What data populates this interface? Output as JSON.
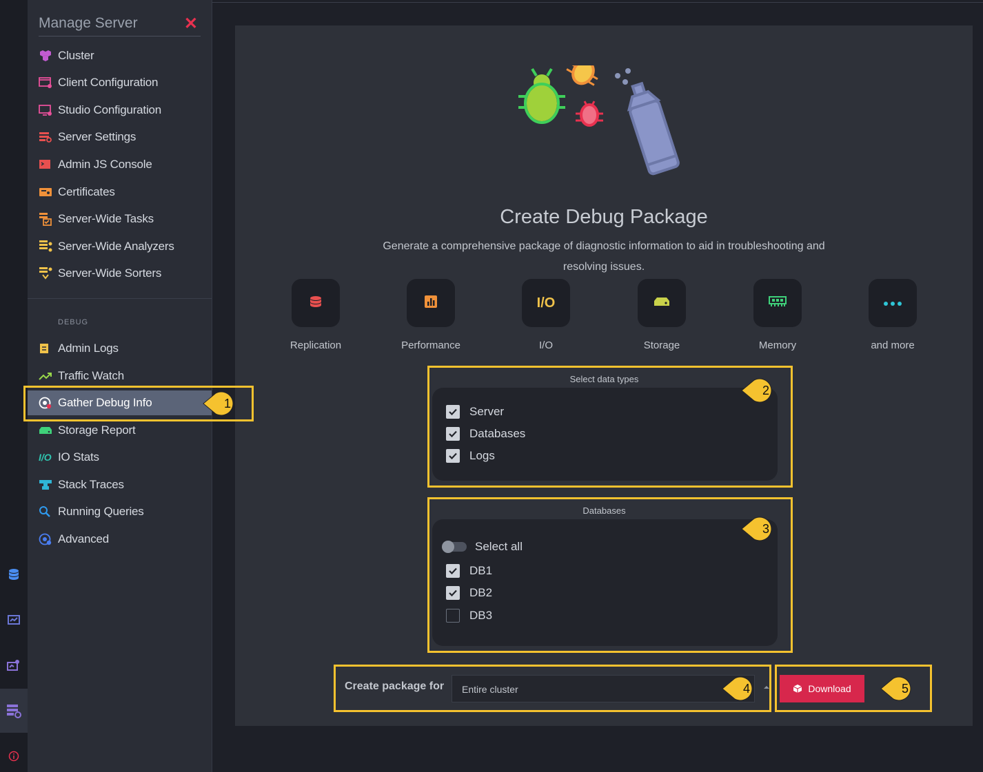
{
  "sidebar": {
    "title": "Manage Server",
    "items": [
      {
        "label": "Cluster",
        "icon": "cluster-icon"
      },
      {
        "label": "Client Configuration",
        "icon": "client-configuration-icon"
      },
      {
        "label": "Studio Configuration",
        "icon": "studio-configuration-icon"
      },
      {
        "label": "Server Settings",
        "icon": "server-settings-icon"
      },
      {
        "label": "Admin JS Console",
        "icon": "admin-console-icon"
      },
      {
        "label": "Certificates",
        "icon": "certificates-icon"
      },
      {
        "label": "Server-Wide Tasks",
        "icon": "server-wide-tasks-icon"
      },
      {
        "label": "Server-Wide Analyzers",
        "icon": "server-wide-analyzers-icon"
      },
      {
        "label": "Server-Wide Sorters",
        "icon": "server-wide-sorters-icon"
      }
    ],
    "debug_section": "DEBUG",
    "debug_items": [
      {
        "label": "Admin Logs",
        "icon": "admin-logs-icon"
      },
      {
        "label": "Traffic Watch",
        "icon": "traffic-watch-icon"
      },
      {
        "label": "Gather Debug Info",
        "icon": "gather-debug-info-icon"
      },
      {
        "label": "Storage Report",
        "icon": "storage-report-icon"
      },
      {
        "label": "IO Stats",
        "icon": "io-stats-icon"
      },
      {
        "label": "Stack Traces",
        "icon": "stack-traces-icon"
      },
      {
        "label": "Running Queries",
        "icon": "running-queries-icon"
      },
      {
        "label": "Advanced",
        "icon": "advanced-icon"
      }
    ],
    "io_glyph": "I/O"
  },
  "main": {
    "title": "Create Debug Package",
    "subtitle": "Generate a comprehensive package of diagnostic information to aid in troubleshooting and resolving issues.",
    "features": [
      {
        "label": "Replication",
        "icon": "replication-icon",
        "color": "#e8504f"
      },
      {
        "label": "Performance",
        "icon": "performance-icon",
        "color": "#f0913a"
      },
      {
        "label": "I/O",
        "icon": "io-icon",
        "color": "#f0c24a"
      },
      {
        "label": "Storage",
        "icon": "storage-icon",
        "color": "#c9d24a"
      },
      {
        "label": "Memory",
        "icon": "memory-icon",
        "color": "#3fd17a"
      },
      {
        "label": "and more",
        "icon": "more-icon",
        "color": "#2fc5d6"
      }
    ],
    "io_glyph": "I/O",
    "data_types": {
      "title": "Select data types",
      "options": [
        {
          "label": "Server",
          "checked": true
        },
        {
          "label": "Databases",
          "checked": true
        },
        {
          "label": "Logs",
          "checked": true
        }
      ]
    },
    "databases": {
      "title": "Databases",
      "select_all": "Select all",
      "items": [
        {
          "label": "DB1",
          "checked": true
        },
        {
          "label": "DB2",
          "checked": true
        },
        {
          "label": "DB3",
          "checked": false
        }
      ]
    },
    "package_for_label": "Create package for",
    "package_for_value": "Entire cluster",
    "download_label": "Download"
  },
  "callouts": [
    "1",
    "2",
    "3",
    "4",
    "5"
  ],
  "colors": {
    "highlight": "#f5c22f",
    "accent": "#d7274c",
    "close": "#e8314f"
  }
}
